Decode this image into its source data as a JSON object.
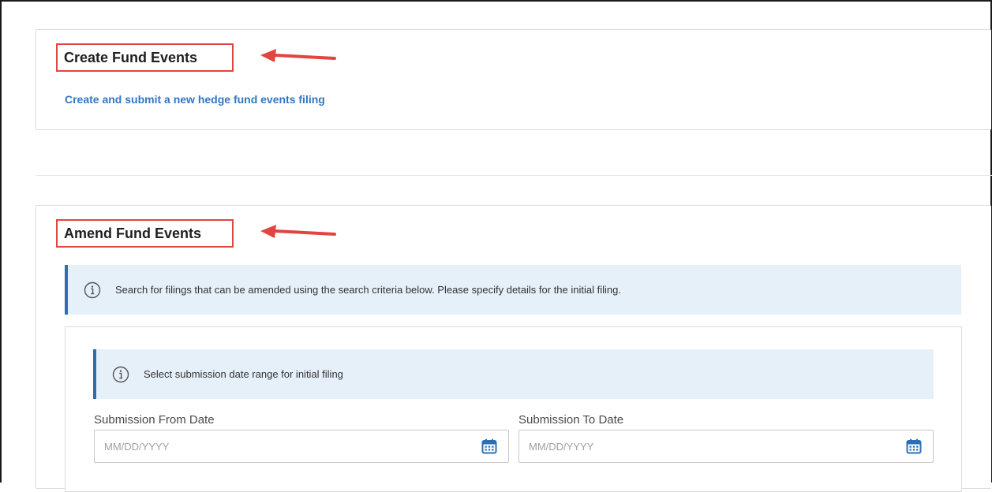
{
  "create_section": {
    "heading": "Create Fund Events",
    "link_label": "Create and submit a new hedge fund events filing"
  },
  "amend_section": {
    "heading": "Amend Fund Events",
    "info_text": "Search for filings that can be amended using the search criteria below. Please specify details for the initial filing.",
    "date_range_info": "Select submission date range for initial filing",
    "from_date": {
      "label": "Submission From Date",
      "placeholder": "MM/DD/YYYY",
      "value": ""
    },
    "to_date": {
      "label": "Submission To Date",
      "placeholder": "MM/DD/YYYY",
      "value": ""
    }
  },
  "colors": {
    "highlight_box": "#e0453f",
    "link": "#2f78c4",
    "info_bg": "#e6f0f8",
    "info_accent": "#2a6fb5",
    "calendar_icon": "#2a6fb5"
  },
  "icons": {
    "annotation_arrow": "arrow-left-icon",
    "info": "info-circle-icon",
    "calendar": "calendar-icon"
  }
}
